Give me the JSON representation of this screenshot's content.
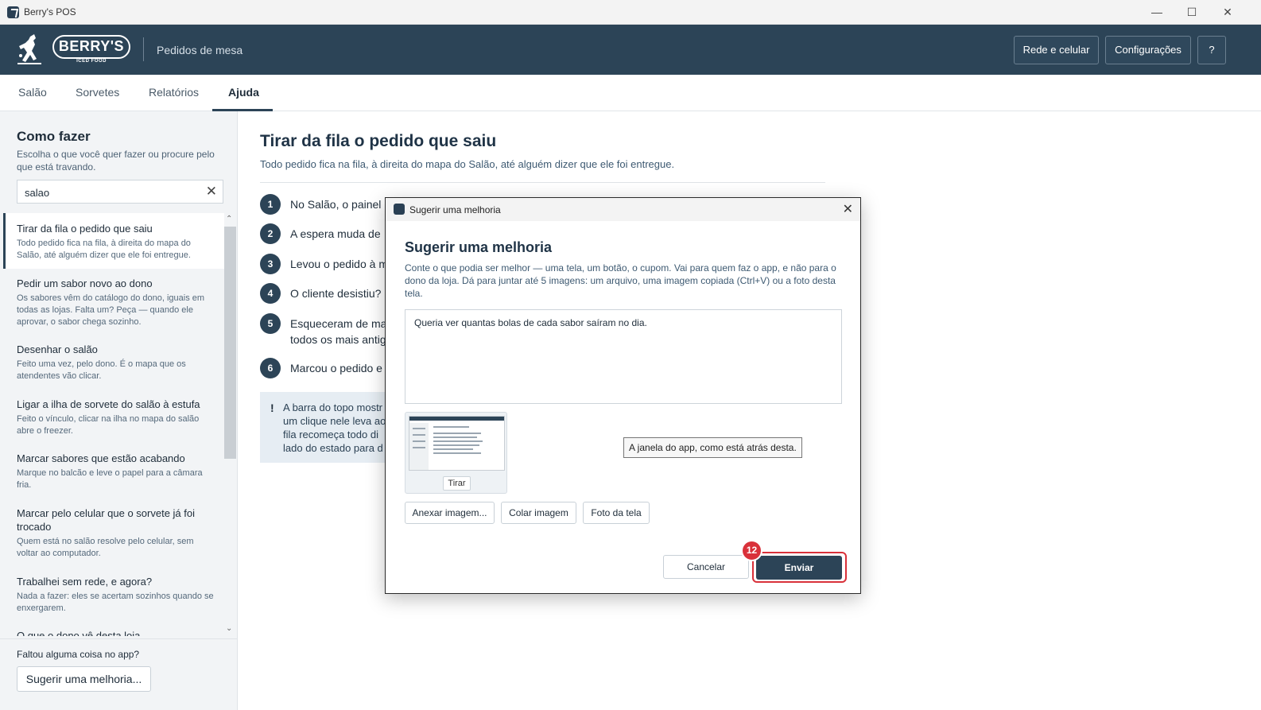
{
  "window": {
    "title": "Berry's POS"
  },
  "header": {
    "logo_text": "BERRY'S",
    "logo_sub": "ICED FOOD",
    "subtitle": "Pedidos de mesa",
    "buttons": {
      "network": "Rede e celular",
      "settings": "Configurações",
      "help": "?"
    }
  },
  "tabs": [
    {
      "label": "Salão"
    },
    {
      "label": "Sorvetes"
    },
    {
      "label": "Relatórios"
    },
    {
      "label": "Ajuda",
      "active": true
    }
  ],
  "sidebar": {
    "title": "Como fazer",
    "desc": "Escolha o que você quer fazer ou procure pelo que está travando.",
    "search_value": "salao",
    "items": [
      {
        "title": "Tirar da fila o pedido que saiu",
        "desc": "Todo pedido fica na fila, à direita do mapa do Salão, até alguém dizer que ele foi entregue.",
        "selected": true
      },
      {
        "title": "Pedir um sabor novo ao dono",
        "desc": "Os sabores vêm do catálogo do dono, iguais em todas as lojas. Falta um? Peça — quando ele aprovar, o sabor chega sozinho."
      },
      {
        "title": "Desenhar o salão",
        "desc": "Feito uma vez, pelo dono. É o mapa que os atendentes vão clicar."
      },
      {
        "title": "Ligar a ilha de sorvete do salão à estufa",
        "desc": "Feito o vínculo, clicar na ilha no mapa do salão abre o freezer."
      },
      {
        "title": "Marcar sabores que estão acabando",
        "desc": "Marque no balcão e leve o papel para a câmara fria."
      },
      {
        "title": "Marcar pelo celular que o sorvete já foi trocado",
        "desc": "Quem está no salão resolve pelo celular, sem voltar ao computador."
      },
      {
        "title": "Trabalhei sem rede, e agora?",
        "desc": "Nada a fazer: eles se acertam sozinhos quando se enxergarem."
      },
      {
        "title": "O que o dono vê desta loja",
        "desc": ""
      }
    ],
    "footer_question": "Faltou alguma coisa no app?",
    "footer_button": "Sugerir uma melhoria..."
  },
  "main": {
    "title": "Tirar da fila o pedido que saiu",
    "subtitle": "Todo pedido fica na fila, à direita do mapa do Salão, até alguém dizer que ele foi entregue.",
    "steps": [
      {
        "num": "1",
        "text": "No Salão, o painel"
      },
      {
        "num": "2",
        "text": "A espera muda de"
      },
      {
        "num": "3",
        "text": "Levou o pedido à m"
      },
      {
        "num": "4",
        "text": "O cliente desistiu?"
      },
      {
        "num": "5",
        "text": "Esqueceram de ma",
        "text2": "todos os mais antig"
      },
      {
        "num": "6",
        "text": "Marcou o pedido e"
      }
    ],
    "note_lines": [
      "A barra do topo mostr",
      "um clique nele leva ao",
      "fila recomeça todo di",
      "lado do estado para d"
    ]
  },
  "dialog": {
    "window_title": "Sugerir uma melhoria",
    "heading": "Sugerir uma melhoria",
    "description": "Conte o que podia ser melhor — uma tela, um botão, o cupom. Vai para quem faz o app, e não para o dono da loja. Dá para juntar até 5 imagens: um arquivo, uma imagem copiada (Ctrl+V) ou a foto desta tela.",
    "text_value": "Queria ver quantas bolas de cada sabor saíram no dia.",
    "thumb_remove": "Tirar",
    "tooltip": "A janela do app, como está atrás desta.",
    "attach": "Anexar imagem...",
    "paste": "Colar imagem",
    "screenshot": "Foto da tela",
    "cancel": "Cancelar",
    "send": "Enviar",
    "step_badge": "12"
  }
}
